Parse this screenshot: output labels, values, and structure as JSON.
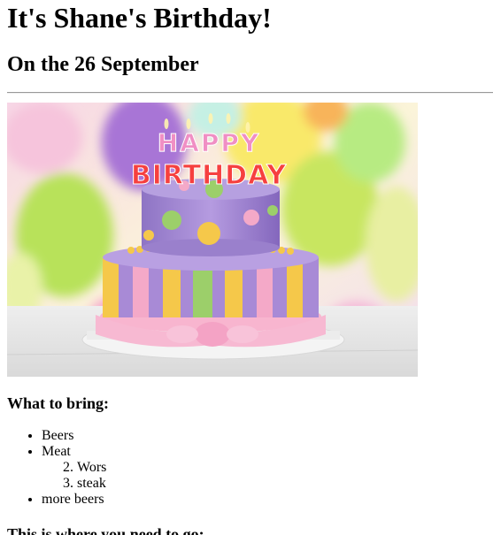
{
  "page": {
    "title": "It's Shane's Birthday!",
    "date_heading": "On the 26 September"
  },
  "image": {
    "cake_text_top": "HAPPY",
    "cake_text_bottom": "BIRTHDAY"
  },
  "bring": {
    "heading": "What to bring:",
    "items": [
      {
        "label": "Beers"
      },
      {
        "label": "Meat",
        "subitems": [
          {
            "number": 2,
            "label": "Wors"
          },
          {
            "number": 3,
            "label": "steak"
          }
        ]
      },
      {
        "label": "more beers"
      }
    ]
  },
  "location": {
    "heading": "This is where you need to go:"
  },
  "colors": {
    "text": "#000000",
    "rule": "#9a9a9a",
    "cake_purple": "#9b7fc9",
    "cake_yellow": "#f5c84a",
    "cake_pink": "#f4a9c8",
    "cake_green": "#9ccf6a"
  }
}
